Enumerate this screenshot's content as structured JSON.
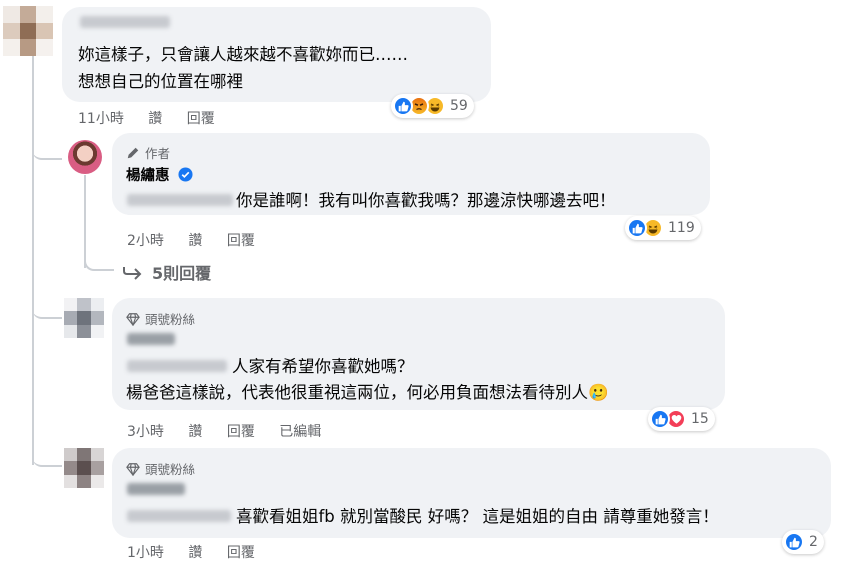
{
  "comments": [
    {
      "lines": [
        "妳這樣子，只會讓人越來越不喜歡妳而已……",
        "想想自己的位置在哪裡"
      ],
      "time": "11小時",
      "like": "讚",
      "reply": "回覆",
      "reaction_count": "59",
      "reactions": [
        "like-icon",
        "angry-icon",
        "haha-icon"
      ]
    },
    {
      "badge": "作者",
      "author": "楊繡惠",
      "verified_icon": "verified-icon",
      "lines": [
        "你是誰啊！我有叫你喜歡我嗎？那邊涼快哪邊去吧！"
      ],
      "time": "2小時",
      "like": "讚",
      "reply": "回覆",
      "reaction_count": "119",
      "reactions": [
        "like-icon",
        "haha-icon"
      ]
    },
    {
      "badge": "頭號粉絲",
      "lines": [
        "人家有希望你喜歡她嗎？",
        "楊爸爸這樣說，代表他很重視這兩位，何必用負面想法看待別人"
      ],
      "emoji": "🥲",
      "time": "3小時",
      "like": "讚",
      "reply": "回覆",
      "edited": "已編輯",
      "reaction_count": "15",
      "reactions": [
        "like-icon",
        "love-icon"
      ]
    },
    {
      "badge": "頭號粉絲",
      "lines": [
        "喜歡看姐姐fb 就別當酸民 好嗎？ 這是姐姐的自由 請尊重她發言！"
      ],
      "time": "1小時",
      "like": "讚",
      "reply": "回覆",
      "reaction_count": "2",
      "reactions": [
        "like-icon"
      ]
    }
  ],
  "more_replies": "5則回覆",
  "colors": {
    "bubble": "#f0f2f5",
    "meta": "#65676b",
    "like_blue": "#1877f2",
    "love_red": "#f33e58",
    "haha_yellow": "#f7b928",
    "angry_orange": "#e9710f",
    "thread_line": "#ccd0d5"
  }
}
